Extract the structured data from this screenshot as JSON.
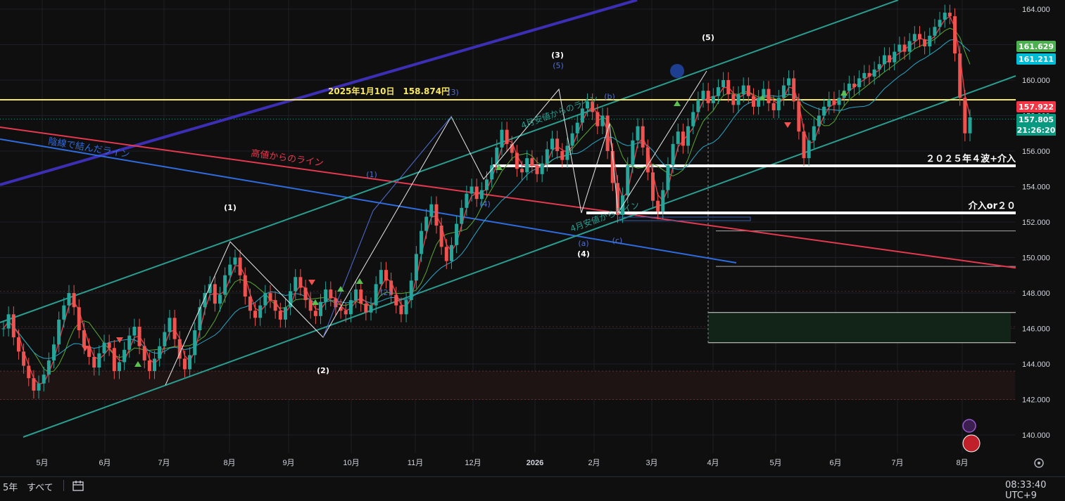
{
  "chart_data": {
    "type": "candlestick",
    "price_axis": {
      "ticks": [
        "164.000",
        "162.000",
        "160.000",
        "158.000",
        "156.000",
        "154.000",
        "152.000",
        "150.000",
        "148.000",
        "146.000",
        "144.000",
        "142.000",
        "140.000"
      ],
      "ylim": [
        139.0,
        165.0
      ]
    },
    "time_axis": {
      "ticks": [
        "5月",
        "6月",
        "7月",
        "8月",
        "9月",
        "10月",
        "11月",
        "12月",
        "2026",
        "2月",
        "3月",
        "4月",
        "5月",
        "6月",
        "7月",
        "8月"
      ]
    },
    "price_labels": [
      {
        "text": "161.629",
        "color": "#4caf50"
      },
      {
        "text": "161.211",
        "color": "#00bcd4"
      },
      {
        "text": "157.922",
        "color": "#f23645"
      },
      {
        "text": "157.805",
        "color": "#089981"
      },
      {
        "text": "21:26:20",
        "color": "#089981"
      }
    ],
    "annotations": {
      "yellow_line": "2025年1月10日　158.874円",
      "blue_line": "陰線で結んだライン",
      "red_line": "高値からのライン",
      "green_line_1": "4月安値からのライン",
      "green_line_2": "4月安値からライン",
      "white_line_1": "２０２５年４波+介入",
      "white_line_2": "介入or２０"
    },
    "wave_labels_white": [
      "(1)",
      "(2)",
      "(3)",
      "(4)",
      "(5)"
    ],
    "wave_labels_blue": [
      "(1)",
      "(2)",
      "(3)",
      "(4)",
      "(5)",
      "(3)",
      "(a)",
      "(b)",
      "(c)"
    ],
    "series": [
      {
        "values": [
          146.0,
          146.8,
          145.5,
          144.7,
          143.9,
          143.2,
          142.5,
          142.9,
          143.4,
          144.2,
          145.1,
          146.5,
          147.3,
          148.0,
          147.2,
          145.9,
          145.0,
          144.4,
          143.8,
          144.6,
          145.2,
          144.9,
          143.6,
          144.1,
          144.8,
          145.6,
          146.1,
          145.0,
          144.2,
          143.6,
          144.3,
          145.0,
          145.8,
          146.6,
          145.4,
          144.3,
          143.7,
          144.5,
          145.9,
          147.2,
          148.0,
          148.5,
          147.4,
          147.9,
          149.0,
          149.6,
          150.0,
          149.0,
          147.8,
          147.0,
          146.6,
          147.3,
          148.0,
          147.6,
          147.0,
          146.5,
          147.2,
          148.1,
          148.9,
          148.3,
          147.6,
          147.0,
          146.7,
          147.5,
          148.2,
          147.7,
          147.2,
          147.0,
          146.8,
          147.6,
          148.2,
          147.4,
          146.9,
          147.3,
          148.5,
          149.3,
          148.7,
          147.9,
          147.3,
          146.8,
          147.6,
          148.7,
          150.2,
          151.5,
          152.3,
          153.0,
          151.8,
          150.6,
          149.8,
          150.7,
          151.9,
          152.8,
          153.6,
          154.0,
          153.3,
          153.8,
          154.4,
          155.2,
          156.2,
          157.2,
          156.4,
          155.9,
          155.0,
          154.8,
          155.6,
          155.2,
          154.7,
          155.3,
          156.1,
          156.7,
          156.0,
          155.5,
          156.3,
          157.0,
          157.6,
          158.4,
          158.8,
          158.2,
          157.4,
          158.0,
          156.0,
          154.2,
          152.4,
          153.5,
          155.2,
          156.6,
          157.4,
          156.2,
          154.8,
          153.2,
          152.6,
          153.8,
          155.2,
          156.4,
          157.1,
          156.3,
          157.4,
          158.2,
          158.9,
          159.4,
          158.7,
          159.1,
          159.6,
          160.0,
          159.2,
          158.6,
          159.2,
          159.7,
          159.1,
          158.5,
          159.0,
          159.5,
          158.7,
          158.3,
          159.0,
          159.7,
          160.1,
          158.8,
          157.1,
          155.6,
          156.6,
          157.4,
          158.0,
          158.5,
          158.9,
          158.6,
          159.0,
          159.4,
          159.8,
          159.6,
          160.1,
          160.4,
          160.2,
          160.6,
          160.9,
          161.4,
          161.0,
          161.6,
          162.0,
          161.6,
          162.2,
          162.6,
          162.3,
          161.9,
          162.5,
          163.0,
          163.4,
          163.8,
          163.6,
          161.5,
          159.0,
          157.0,
          157.9
        ]
      }
    ]
  }
}
